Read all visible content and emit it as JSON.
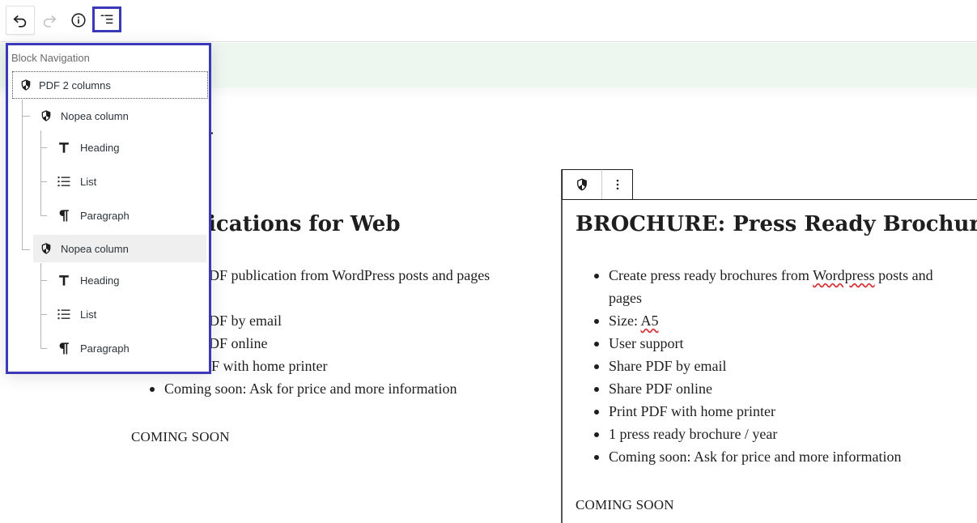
{
  "toolbar": {
    "undo_icon": "undo-icon",
    "redo_icon": "redo-icon",
    "info_icon": "info-icon",
    "navigation_icon": "list-view-icon"
  },
  "editor": {
    "partial_title": "g",
    "left_column": {
      "heading": "blications for Web",
      "items": [
        "DF publication from WordPress posts and pages",
        "DF by email",
        "DF online",
        "F with home printer",
        "Coming soon: Ask for price and more information"
      ],
      "footer": "COMING SOON"
    },
    "right_column": {
      "heading": "BROCHURE: Press Ready Brochure",
      "items": [
        {
          "pre": "Create press ready brochures from ",
          "mark": "Wordpress",
          "post": " posts and pages"
        },
        {
          "pre": "Size: ",
          "mark": "A5",
          "post": ""
        },
        {
          "pre": "User support",
          "mark": "",
          "post": ""
        },
        {
          "pre": "Share PDF by email",
          "mark": "",
          "post": ""
        },
        {
          "pre": "Share PDF online",
          "mark": "",
          "post": ""
        },
        {
          "pre": "Print PDF with home printer",
          "mark": "",
          "post": ""
        },
        {
          "pre": "1 press ready brochure / year",
          "mark": "",
          "post": ""
        },
        {
          "pre": "Coming soon: Ask for price and more information",
          "mark": "",
          "post": ""
        }
      ],
      "footer": "COMING SOON"
    }
  },
  "block_navigation": {
    "title": "Block Navigation",
    "root": {
      "label": "PDF 2 columns",
      "icon": "shield-icon"
    },
    "columns": [
      {
        "label": "Nopea column",
        "icon": "shield-icon",
        "children": [
          {
            "label": "Heading",
            "icon": "heading-icon"
          },
          {
            "label": "List",
            "icon": "list-icon"
          },
          {
            "label": "Paragraph",
            "icon": "paragraph-icon"
          }
        ]
      },
      {
        "label": "Nopea column",
        "icon": "shield-icon",
        "children": [
          {
            "label": "Heading",
            "icon": "heading-icon"
          },
          {
            "label": "List",
            "icon": "list-icon"
          },
          {
            "label": "Paragraph",
            "icon": "paragraph-icon"
          }
        ]
      }
    ]
  },
  "colors": {
    "accent": "#3a3ab8",
    "notice_background": "#eef7ef",
    "spellcheck_underline": "#d63638"
  }
}
